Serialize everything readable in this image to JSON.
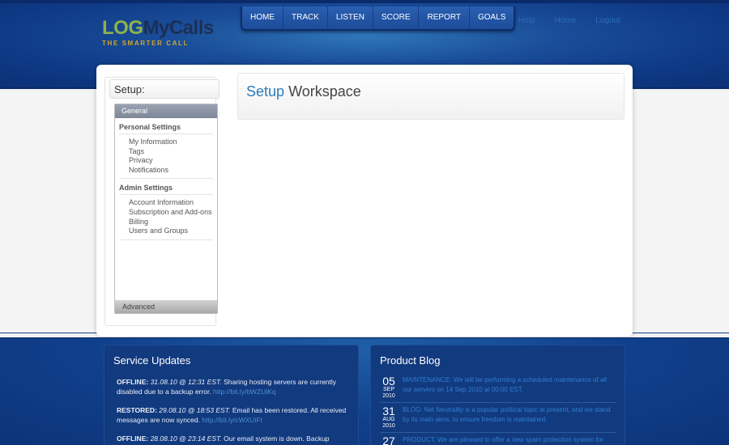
{
  "brand": {
    "log": "LOG",
    "calls": "MyCalls",
    "tagline": "THE SMARTER CALL"
  },
  "topnav": [
    "HOME",
    "TRACK",
    "LISTEN",
    "SCORE",
    "REPORT",
    "GOALS"
  ],
  "userlinks": [
    "Help",
    "Home",
    "Logout"
  ],
  "setup": {
    "title": "Setup:"
  },
  "menu": {
    "general": "General",
    "personal_title": "Personal Settings",
    "personal_items": [
      "My Information",
      "Tags",
      "Privacy",
      "Notifications"
    ],
    "admin_title": "Admin Settings",
    "admin_items": [
      "Account Information",
      "Subscription and Add-ons",
      "Billing",
      "Users and Groups"
    ],
    "advanced": "Advanced"
  },
  "workspace": {
    "title_a": "Setup",
    "title_b": "Workspace"
  },
  "service_updates": {
    "title": "Service Updates",
    "items": [
      {
        "status": "OFFLINE:",
        "datetime": "31.08.10 @ 12:31 EST.",
        "text": "Sharing hosting servers are currently disabled due to a backup error.",
        "link": "http://bit.ly/bWZUiKq"
      },
      {
        "status": "RESTORED:",
        "datetime": "29.08.10 @ 18:53 EST.",
        "text": "Email has been restored. All received messages are now synced.",
        "link": "http://bit.ly/cWXUiFt"
      },
      {
        "status": "OFFLINE:",
        "datetime": "28.08.10 @ 23:14 EST.",
        "text": "Our email system is down. Backup",
        "link": ""
      }
    ]
  },
  "product_blog": {
    "title": "Product Blog",
    "items": [
      {
        "day": "05",
        "month": "SEP",
        "year": "2010",
        "text": "MAINTENANCE: We will be performing a scheduled maintenance of all our servers on 14 Sep 2010 at 00:00 EST."
      },
      {
        "day": "31",
        "month": "AUG",
        "year": "2010",
        "text": "BLOG: Net Neutrality is a popular political topic at present, and we stand by its main aims, to ensure freedom is maintained."
      },
      {
        "day": "27",
        "month": "",
        "year": "",
        "text": "PRODUCT: We are pleased to offer a new spam protection system for"
      }
    ]
  },
  "colors": {
    "header_blue": "#0f3a86",
    "accent_blue": "#2b7dbd",
    "logo_green": "#8fb24a",
    "tagline_gold": "#d2a62a"
  }
}
